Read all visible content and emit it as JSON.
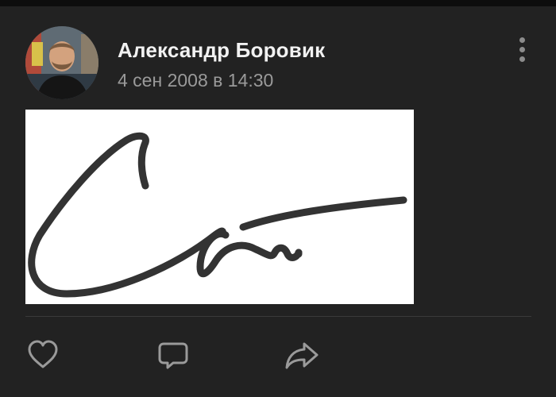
{
  "post": {
    "author": "Александр Боровик",
    "timestamp": "4 сен 2008 в 14:30"
  },
  "icons": {
    "more": "more-vertical-icon",
    "like": "heart-icon",
    "comment": "comment-icon",
    "share": "share-icon"
  },
  "colors": {
    "background": "#222222",
    "author_text": "#f2f2f2",
    "secondary_text": "#9a9a9a",
    "icon": "#9a9a9a",
    "signature_ink": "#333333"
  }
}
